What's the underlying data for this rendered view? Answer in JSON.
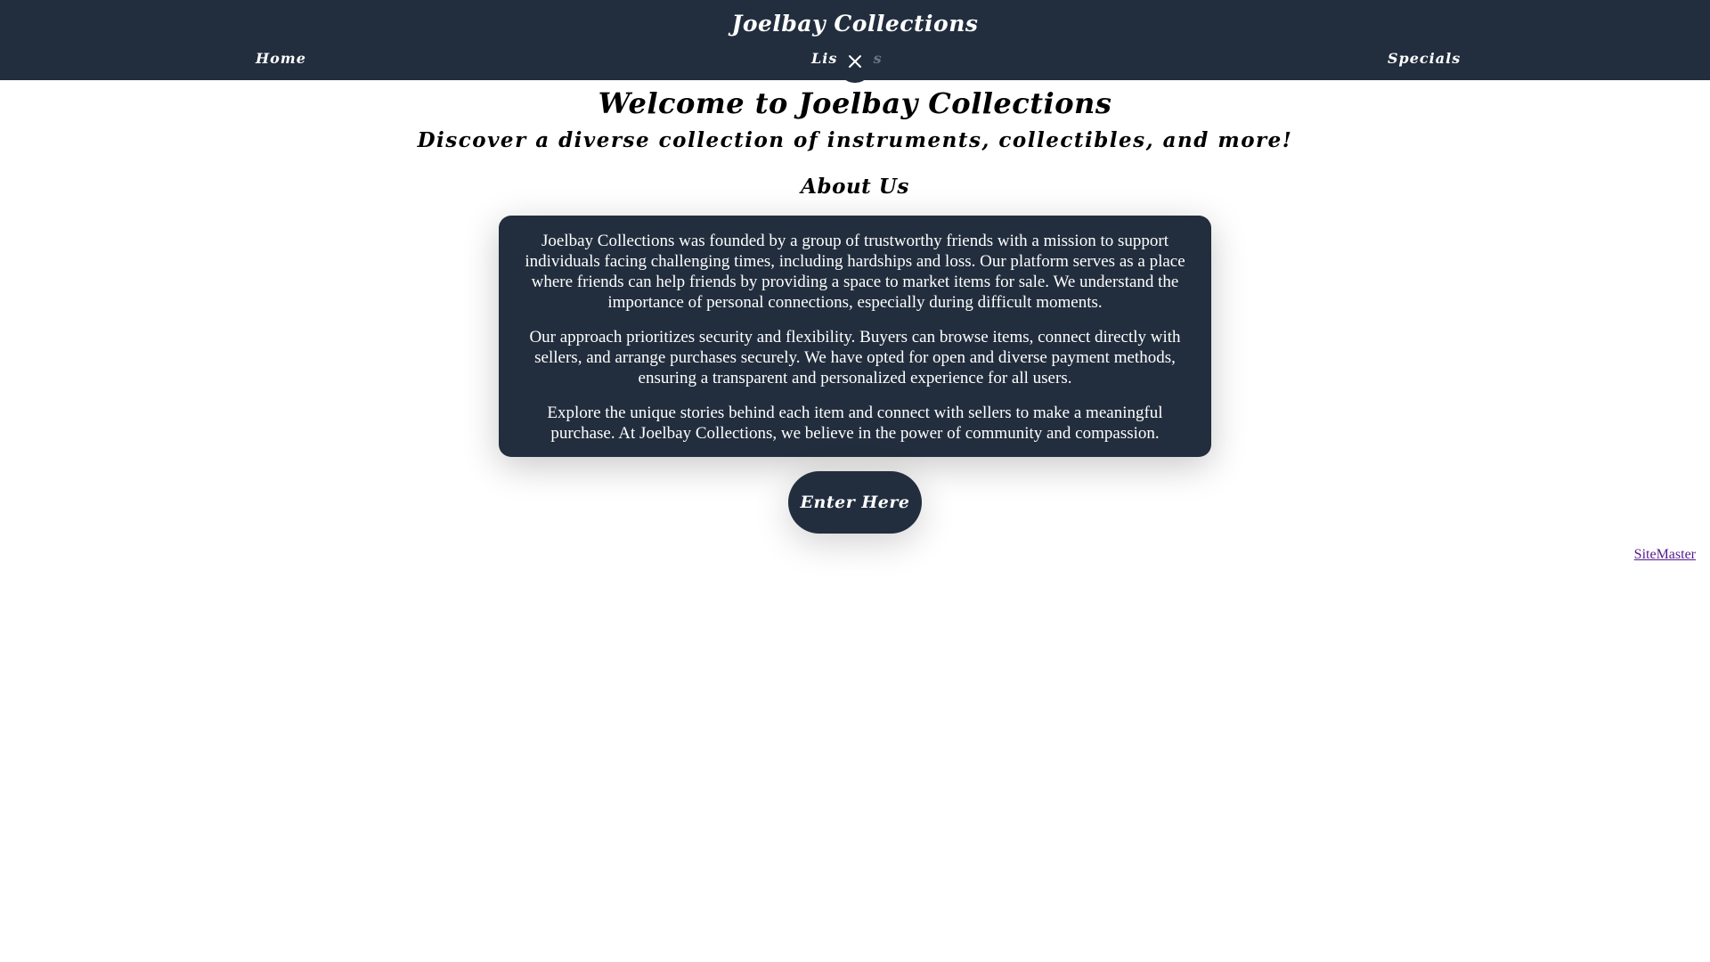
{
  "header": {
    "title": "Joelbay Collections",
    "nav": {
      "home": "Home",
      "listings_visible": "Lis",
      "listings_faded": "tings",
      "specials": "Specials"
    }
  },
  "main": {
    "heading": "Welcome to Joelbay Collections",
    "subheading": "Discover a diverse collection of instruments, collectibles, and more!",
    "about_heading": "About Us",
    "about_paragraphs": [
      "Joelbay Collections was founded by a group of trustworthy friends with a mission to support individuals facing challenging times, including hardships and loss. Our platform serves as a place where friends can help friends by providing a space to market items for sale. We understand the importance of personal connections, especially during difficult moments.",
      "Our approach prioritizes security and flexibility. Buyers can browse items, connect directly with sellers, and arrange purchases securely. We have opted for open and diverse payment methods, ensuring a transparent and personalized experience for all users.",
      "Explore the unique stories behind each item and connect with sellers to make a meaningful purchase. At Joelbay Collections, we believe in the power of community and compassion."
    ],
    "enter_button": "Enter Here"
  },
  "footer": {
    "link": "SiteMaster"
  },
  "colors": {
    "header_bg": "#222e3e",
    "card_bg": "#222e3e",
    "text_light": "#ffffff",
    "visited_link": "#551a8b"
  },
  "icons": {
    "close": "close-icon"
  }
}
